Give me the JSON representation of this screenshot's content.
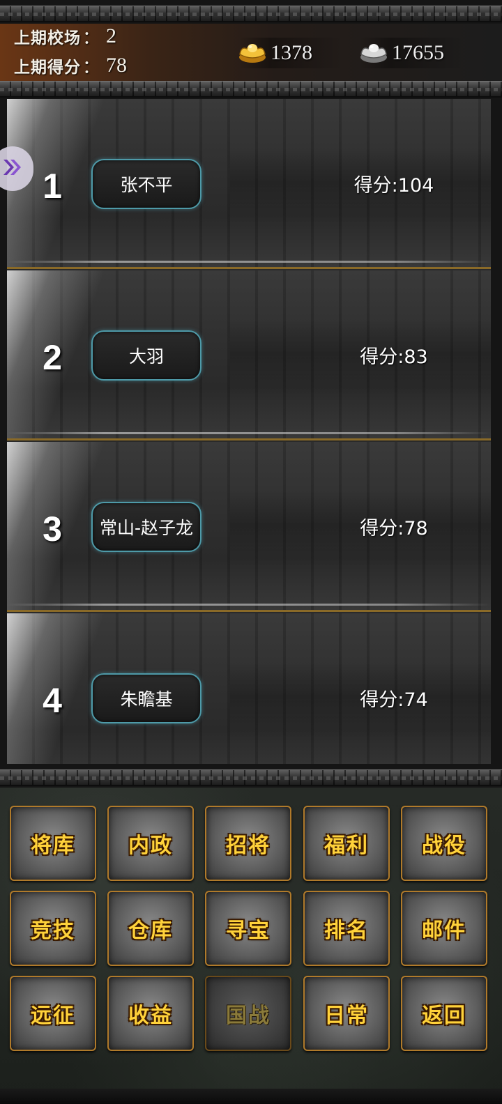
{
  "header": {
    "last_field_label": "上期校场",
    "last_field_colon": "：",
    "last_field_value": "2",
    "last_score_label": "上期得分",
    "last_score_colon": "：",
    "last_score_value": "78",
    "gold": {
      "icon": "gold-ingot-icon",
      "amount": "1378"
    },
    "silver": {
      "icon": "silver-ingot-icon",
      "amount": "17655"
    }
  },
  "rankings": [
    {
      "rank": "1",
      "name": "张不平",
      "score": "得分:104"
    },
    {
      "rank": "2",
      "name": "大羽",
      "score": "得分:83"
    },
    {
      "rank": "3",
      "name": "常山-赵子龙",
      "score": "得分:78"
    },
    {
      "rank": "4",
      "name": "朱瞻基",
      "score": "得分:74"
    }
  ],
  "menu": {
    "rows": [
      [
        "将库",
        "内政",
        "招将",
        "福利",
        "战役"
      ],
      [
        "竞技",
        "仓库",
        "寻宝",
        "排名",
        "邮件"
      ],
      [
        "远征",
        "收益",
        "国战",
        "日常",
        "返回"
      ]
    ],
    "disabled_item": "国战"
  },
  "colors": {
    "accent_gold": "#ffd23a",
    "pill_border": "#4e9aa8",
    "divider_gold": "#8a6a28",
    "header_brown": "#6a3615"
  }
}
